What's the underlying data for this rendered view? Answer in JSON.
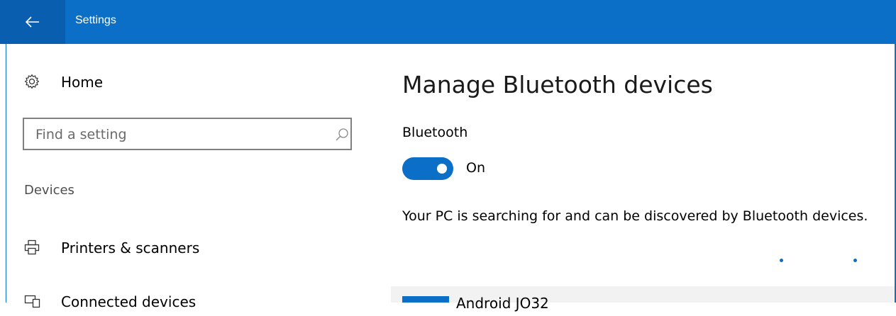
{
  "titlebar": {
    "app_title": "Settings",
    "back_icon": "arrow-left-icon",
    "color": "#0b6fc8"
  },
  "sidebar": {
    "home": {
      "label": "Home",
      "icon": "gear-icon"
    },
    "search": {
      "placeholder": "Find a setting",
      "icon": "search-icon"
    },
    "section_label": "Devices",
    "items": [
      {
        "label": "Printers & scanners",
        "icon": "printer-icon"
      },
      {
        "label": "Connected devices",
        "icon": "connected-devices-icon"
      }
    ]
  },
  "main": {
    "title": "Manage Bluetooth devices",
    "bluetooth": {
      "label": "Bluetooth",
      "state": "On",
      "enabled": true
    },
    "description": "Your PC is searching for and can be discovered by Bluetooth devices.",
    "device": {
      "name": "Android JO32",
      "icon": "device-icon"
    }
  },
  "colors": {
    "accent": "#0b6fc8",
    "titlebar": "#0b6fc8",
    "back_button": "#0a5eb0"
  }
}
